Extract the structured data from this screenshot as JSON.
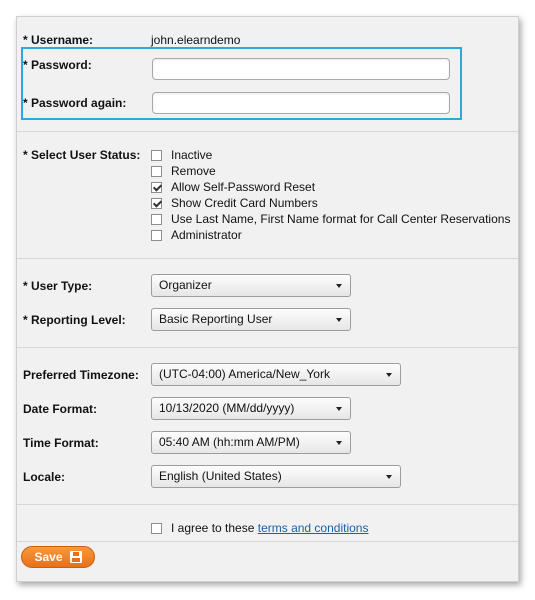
{
  "account": {
    "username_label": "* Username:",
    "username_value": "john.elearndemo",
    "password_label": "* Password:",
    "password_value": "",
    "password_again_label": "* Password again:",
    "password_again_value": ""
  },
  "status": {
    "label": "* Select User Status:",
    "options": [
      {
        "label": "Inactive",
        "checked": false
      },
      {
        "label": "Remove",
        "checked": false
      },
      {
        "label": "Allow Self-Password Reset",
        "checked": true
      },
      {
        "label": "Show Credit Card Numbers",
        "checked": true
      },
      {
        "label": "Use Last Name, First Name format for Call Center Reservations",
        "checked": false
      },
      {
        "label": "Administrator",
        "checked": false
      }
    ]
  },
  "role": {
    "user_type_label": "* User Type:",
    "user_type_value": "Organizer",
    "reporting_level_label": "* Reporting Level:",
    "reporting_level_value": "Basic Reporting User"
  },
  "preferences": {
    "timezone_label": "Preferred Timezone:",
    "timezone_value": "(UTC-04:00) America/New_York",
    "date_format_label": "Date Format:",
    "date_format_value": "10/13/2020 (MM/dd/yyyy)",
    "time_format_label": "Time Format:",
    "time_format_value": "05:40 AM (hh:mm AM/PM)",
    "locale_label": "Locale:",
    "locale_value": "English (United States)"
  },
  "terms": {
    "checked": false,
    "prefix": "I agree to these ",
    "link_text": "terms and conditions"
  },
  "actions": {
    "save_label": "Save"
  },
  "colors": {
    "highlight_border": "#2aa9dd",
    "save_button": "#f08228",
    "link": "#1a5fa8"
  }
}
